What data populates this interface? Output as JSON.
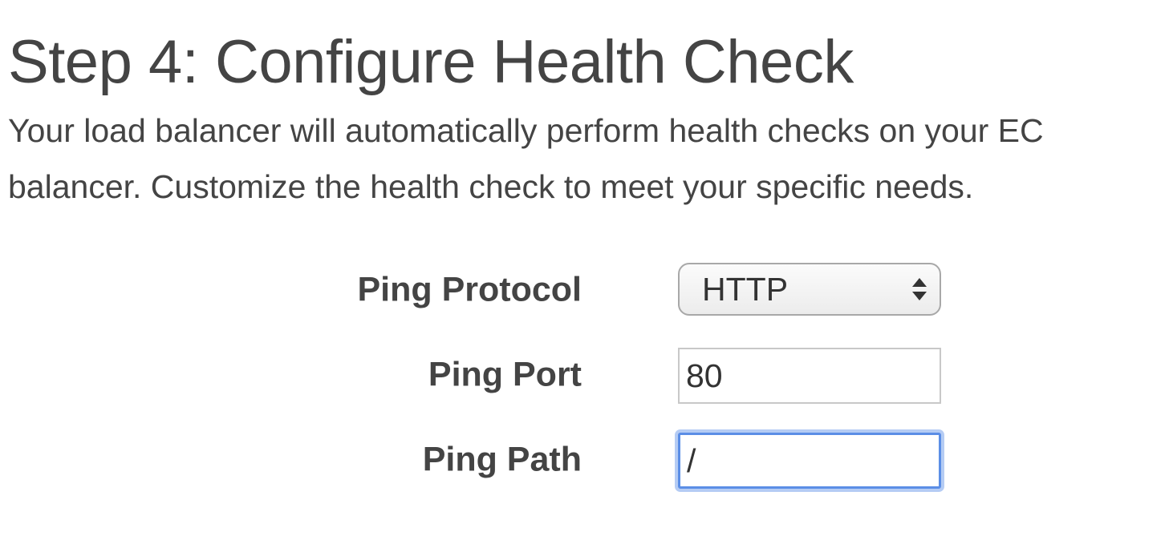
{
  "page": {
    "title": "Step 4: Configure Health Check",
    "description_line1": "Your load balancer will automatically perform health checks on your EC",
    "description_line2": "balancer. Customize the health check to meet your specific needs."
  },
  "form": {
    "ping_protocol": {
      "label": "Ping Protocol",
      "selected_value": "HTTP"
    },
    "ping_port": {
      "label": "Ping Port",
      "value": "80"
    },
    "ping_path": {
      "label": "Ping Path",
      "value": "/",
      "focused": true
    }
  },
  "colors": {
    "text": "#444444",
    "focus_ring": "#5b8ee6",
    "input_border": "#c8c8c8"
  },
  "icons": {
    "select_arrows": "up-down-chevron-icon"
  }
}
